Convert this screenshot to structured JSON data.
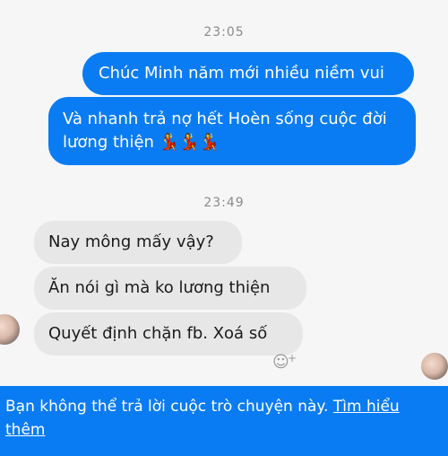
{
  "chat": {
    "timestamps": [
      "23:05",
      "23:49"
    ],
    "outgoing": [
      "Chúc Minh năm mới nhiều niềm vui",
      "Và nhanh trả nợ hết Hoèn sống cuộc đời lương thiện 💃💃💃"
    ],
    "incoming": [
      "Nay mông mấy vậy?",
      "Ăn nói gì mà ko lương thiện",
      "Quyết định chặn fb. Xoá số"
    ],
    "react_icon": "smiley-plus-icon"
  },
  "banner": {
    "text": "Bạn không thể trả lời cuộc trò chuyện này.",
    "link": "Tìm hiểu thêm"
  },
  "colors": {
    "accent": "#0a7cf3",
    "incoming_bubble": "#e7e7e7"
  }
}
